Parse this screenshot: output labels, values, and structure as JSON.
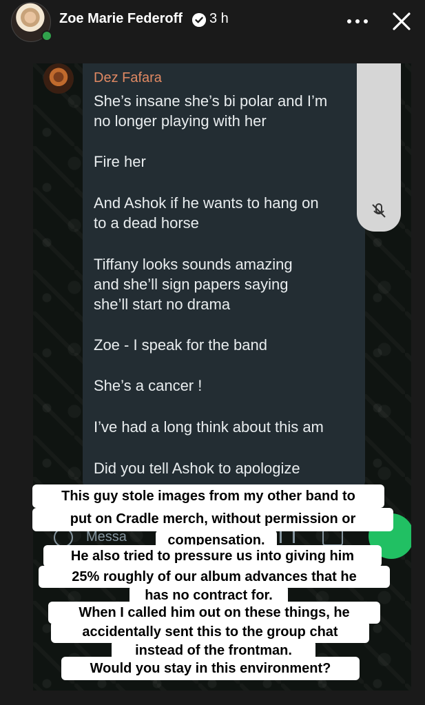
{
  "header": {
    "author": "Zoe Marie Federoff",
    "time": "3 h",
    "verified": true,
    "icons": [
      "more-icon",
      "close-icon",
      "verified-badge-icon"
    ]
  },
  "chat": {
    "sender": "Dez Fafara",
    "sender_color": "#e08963",
    "messages": [
      "She’s insane she’s bi polar and I’m\nno longer playing with her",
      "Fire her",
      "And Ashok if he wants to hang on\nto a dead horse",
      "Tiffany looks sounds amazing\nand she’ll sign papers saying\nshe’ll start no drama",
      "Zoe - I speak for the band",
      "She’s a cancer !",
      "I’ve had a long think about this am",
      "Did you tell Ashok to apologize"
    ],
    "input_placeholder": "Messa",
    "icons": [
      "emoji-icon",
      "attach-icon",
      "camera-icon",
      "mic-icon",
      "muted-mic-icon"
    ]
  },
  "caption": {
    "lines": [
      "This guy stole images from my other band to",
      "put on Cradle merch, without permission or",
      "compensation.",
      "He also tried to pressure us into giving him",
      "25% roughly of our album advances that he",
      "has no contract for.",
      "When I called him out on these things, he",
      "accidentally sent this to the group chat",
      "instead of the frontman.",
      "Would you stay in this environment?"
    ]
  }
}
